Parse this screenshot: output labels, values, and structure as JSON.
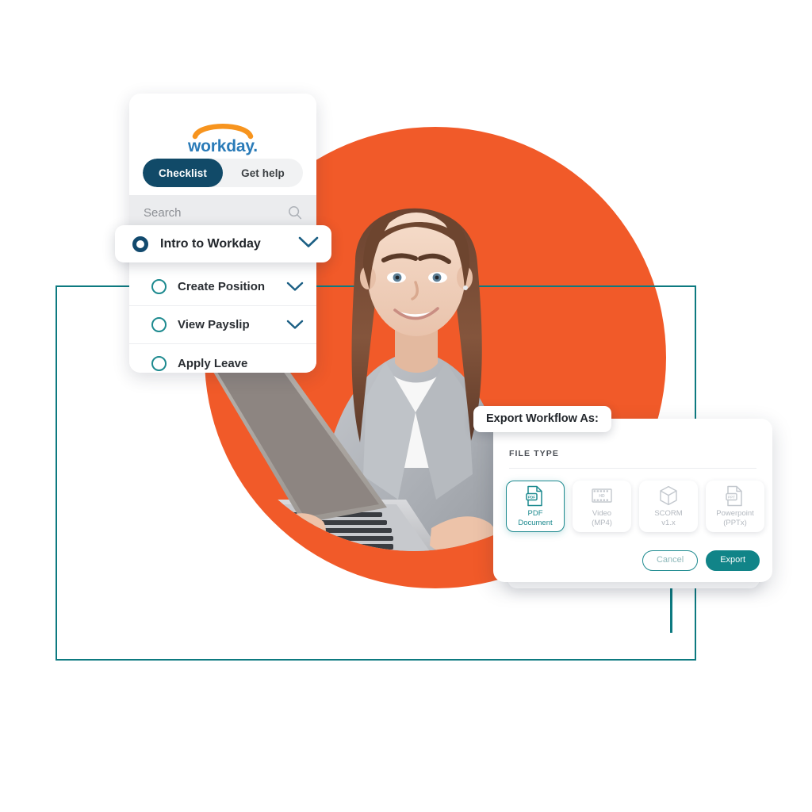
{
  "colors": {
    "orange": "#f15a29",
    "navy": "#114a68",
    "teal": "#1d8a8f",
    "teal_dark": "#118488",
    "logo_blue": "#2a7bb8",
    "logo_orange": "#f7941e",
    "text_dark": "#22262b",
    "muted": "#b3b8bf"
  },
  "checklist_panel": {
    "logo": {
      "name": "workday-logo",
      "wordmark": "workday.",
      "arc_icon": "orange-arc-icon"
    },
    "tabs": [
      {
        "label": "Checklist",
        "active": true
      },
      {
        "label": "Get help",
        "active": false
      }
    ],
    "search": {
      "placeholder": "Search",
      "value": "",
      "icon": "search-icon"
    },
    "items": [
      {
        "label": "Intro to Workday",
        "state": "selected",
        "has_chevron": true,
        "radio": "radio-filled-icon"
      },
      {
        "label": "Create Position",
        "state": "default",
        "has_chevron": true,
        "radio": "radio-empty-icon"
      },
      {
        "label": "View Payslip",
        "state": "default",
        "has_chevron": true,
        "radio": "radio-empty-icon"
      },
      {
        "label": "Apply Leave",
        "state": "default",
        "has_chevron": false,
        "radio": "radio-empty-icon"
      }
    ]
  },
  "export_dialog": {
    "tooltip_label": "Export Workflow As:",
    "section_label": "FILE TYPE",
    "file_types": [
      {
        "title": "PDF",
        "subtitle": "Document",
        "icon": "pdf-file-icon",
        "selected": true
      },
      {
        "title": "Video",
        "subtitle": "(MP4)",
        "icon": "video-filmstrip-icon",
        "selected": false
      },
      {
        "title": "SCORM",
        "subtitle": "v1.x",
        "icon": "scorm-box-icon",
        "selected": false
      },
      {
        "title": "Powerpoint",
        "subtitle": "(PPTx)",
        "icon": "ppt-file-icon",
        "selected": false
      }
    ],
    "buttons": {
      "cancel": "Cancel",
      "export": "Export"
    }
  },
  "decor": {
    "orange_circle": "orange-circle-shape",
    "teal_frame": "teal-outline-rectangle",
    "photo": "smiling-woman-holding-laptop-photo"
  }
}
